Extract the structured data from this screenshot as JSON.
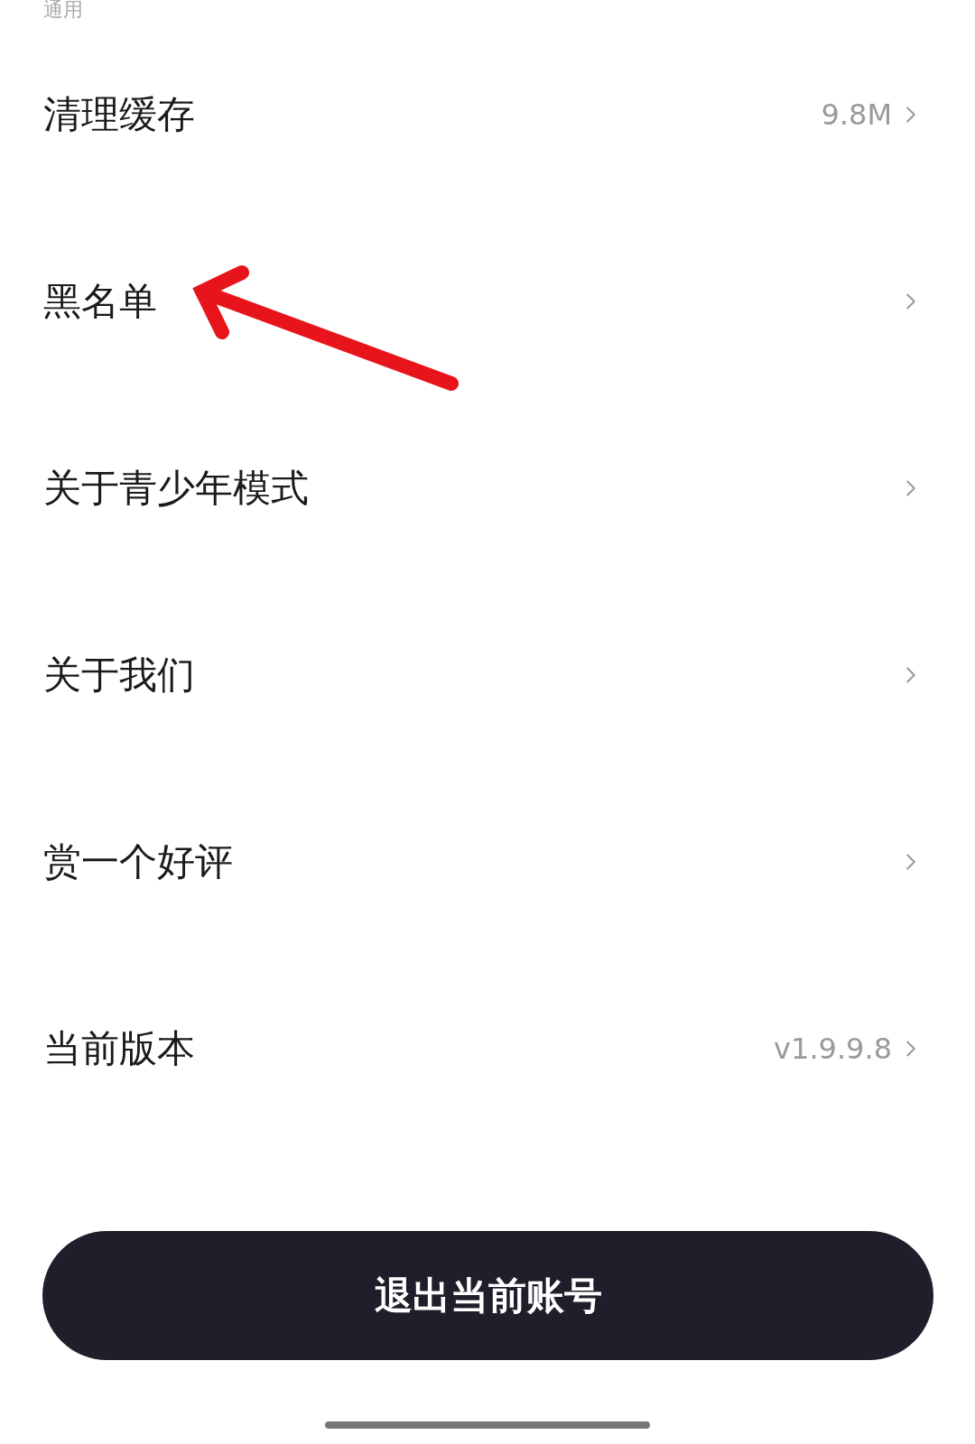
{
  "section_title": "通用",
  "items": [
    {
      "label": "清理缓存",
      "value": "9.8M"
    },
    {
      "label": "黑名单"
    },
    {
      "label": "关于青少年模式"
    },
    {
      "label": "关于我们"
    },
    {
      "label": "赏一个好评"
    },
    {
      "label": "当前版本",
      "value": "v1.9.9.8"
    }
  ],
  "logout_button": "退出当前账号"
}
